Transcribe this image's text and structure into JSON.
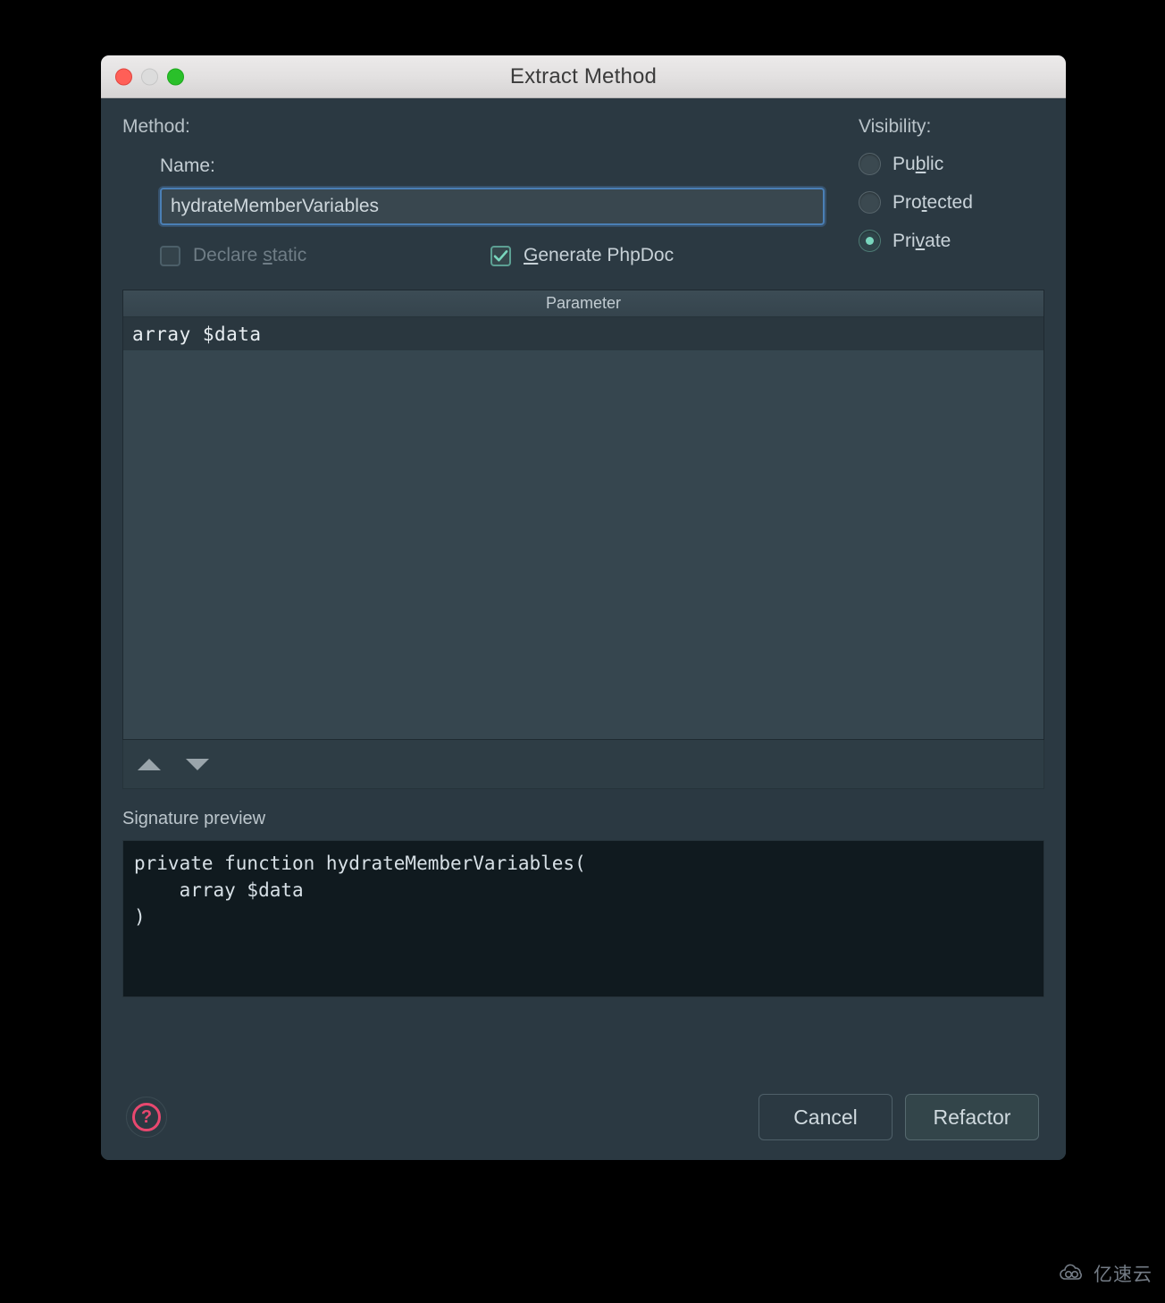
{
  "window": {
    "title": "Extract Method",
    "traffic_lights": [
      "close",
      "minimize",
      "maximize"
    ]
  },
  "method": {
    "group_label": "Method:",
    "name_label": "Name:",
    "name_value": "hydrateMemberVariables",
    "name_placeholder": "",
    "declare_static": {
      "label_prefix": "Declare ",
      "label_mnemonic": "s",
      "label_suffix": "tatic",
      "checked": false,
      "enabled": false
    },
    "generate_phpdoc": {
      "label_mnemonic": "G",
      "label_suffix": "enerate PhpDoc",
      "checked": true,
      "enabled": true
    }
  },
  "visibility": {
    "label": "Visibility:",
    "selected": "Private",
    "options": [
      {
        "prefix": "Pu",
        "mnemonic": "b",
        "suffix": "lic",
        "value": "Public",
        "selected": false
      },
      {
        "prefix": "Pro",
        "mnemonic": "t",
        "suffix": "ected",
        "value": "Protected",
        "selected": false
      },
      {
        "prefix": "Pri",
        "mnemonic": "v",
        "suffix": "ate",
        "value": "Private",
        "selected": true
      }
    ]
  },
  "parameters": {
    "column_header": "Parameter",
    "rows": [
      "array $data"
    ],
    "move_up_icon": "triangle-up-icon",
    "move_down_icon": "triangle-down-icon"
  },
  "signature": {
    "label": "Signature preview",
    "code": "private function hydrateMemberVariables(\n    array $data\n)"
  },
  "footer": {
    "help_icon": "question-mark-icon",
    "help_glyph": "?",
    "cancel_label": "Cancel",
    "refactor_label": "Refactor"
  },
  "watermark": {
    "text": "亿速云",
    "icon": "cloud-logo-icon"
  },
  "colors": {
    "dialog_bg": "#2b3942",
    "titlebar_bg": "#e3e1e1",
    "accent_focus": "#4a7fb5",
    "accent_check": "#79d6bd",
    "help_red": "#e8486f",
    "code_bg": "#101a1f"
  }
}
